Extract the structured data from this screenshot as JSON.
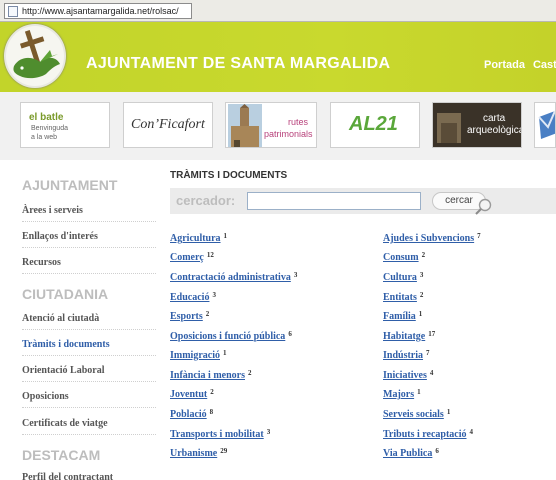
{
  "browser": {
    "url": "http://www.ajsantamargalida.net/rolsac/"
  },
  "header": {
    "title": "AJUNTAMENT DE SANTA MARGALIDA",
    "nav": [
      "Portada",
      "Cast"
    ]
  },
  "banners": {
    "batle": {
      "line1": "el batle",
      "line2": "Benvinguda",
      "line3": "a la web"
    },
    "confia": {
      "text": "Con’Ficafort"
    },
    "rutes": {
      "line1": "rutes",
      "line2": "patrimonials"
    },
    "al21": {
      "text": "AL21"
    },
    "carta": {
      "line1": "carta",
      "line2": "arqueològica"
    }
  },
  "sidebar": {
    "sections": [
      {
        "title": "AJUNTAMENT",
        "items": [
          "Àrees i serveis",
          "Enllaços d'interés",
          "Recursos"
        ]
      },
      {
        "title": "CIUTADANIA",
        "items": [
          "Atenció al ciutadà",
          "Tràmits i documents",
          "Orientació Laboral",
          "Oposicions",
          "Certificats de viatge"
        ]
      },
      {
        "title": "DESTACAM",
        "items": [
          "Perfil del contractant"
        ]
      }
    ]
  },
  "main": {
    "title": "TRÀMITS I DOCUMENTS",
    "search": {
      "label": "cercador:",
      "button": "cercar",
      "value": ""
    },
    "left": [
      {
        "label": "Agricultura",
        "count": "1"
      },
      {
        "label": "Comerç",
        "count": "12"
      },
      {
        "label": "Contractació administrativa",
        "count": "3"
      },
      {
        "label": "Educació",
        "count": "3"
      },
      {
        "label": "Esports",
        "count": "2"
      },
      {
        "label": "Oposicions i funció pública",
        "count": "6"
      },
      {
        "label": "Immigració",
        "count": "1"
      },
      {
        "label": "Infància i menors",
        "count": "2"
      },
      {
        "label": "Joventut",
        "count": "2"
      },
      {
        "label": "Població",
        "count": "8"
      },
      {
        "label": "Transports i mobilitat",
        "count": "3"
      },
      {
        "label": "Urbanisme",
        "count": "29"
      }
    ],
    "right": [
      {
        "label": "Ajudes i Subvencions",
        "count": "7"
      },
      {
        "label": "Consum",
        "count": "2"
      },
      {
        "label": "Cultura",
        "count": "3"
      },
      {
        "label": "Entitats",
        "count": "2"
      },
      {
        "label": "Família",
        "count": "1"
      },
      {
        "label": "Habitatge",
        "count": "17"
      },
      {
        "label": "Indústria",
        "count": "7"
      },
      {
        "label": "Iniciatives",
        "count": "4"
      },
      {
        "label": "Majors",
        "count": "1"
      },
      {
        "label": "Serveis socials",
        "count": "1"
      },
      {
        "label": "Tributs i recaptació",
        "count": "4"
      },
      {
        "label": "Via Publica",
        "count": "6"
      }
    ]
  },
  "colors": {
    "header": "#c4d42a",
    "link": "#2f5ea8",
    "sidebarSection": "#bdbdbd"
  }
}
